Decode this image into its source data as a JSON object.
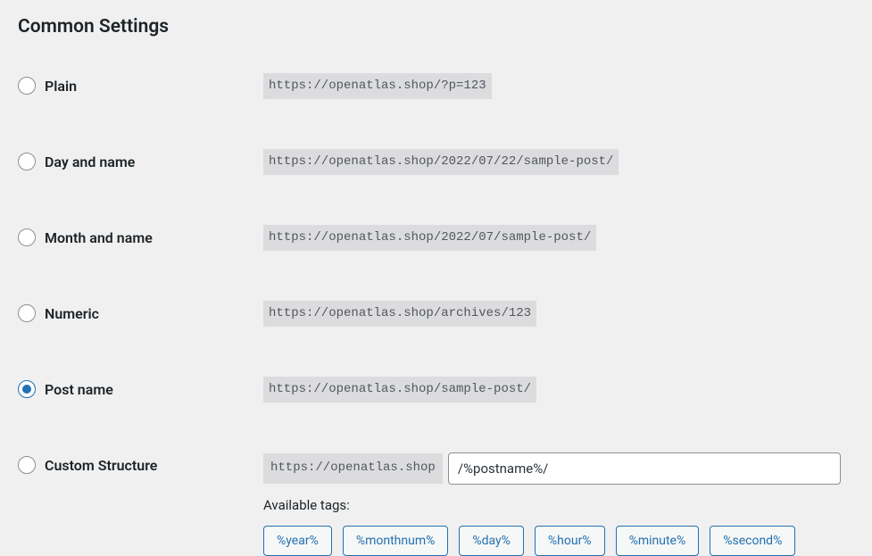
{
  "heading": "Common Settings",
  "options": {
    "plain": {
      "label": "Plain",
      "example": "https://openatlas.shop/?p=123"
    },
    "day_name": {
      "label": "Day and name",
      "example": "https://openatlas.shop/2022/07/22/sample-post/"
    },
    "month_name": {
      "label": "Month and name",
      "example": "https://openatlas.shop/2022/07/sample-post/"
    },
    "numeric": {
      "label": "Numeric",
      "example": "https://openatlas.shop/archives/123"
    },
    "post_name": {
      "label": "Post name",
      "example": "https://openatlas.shop/sample-post/"
    },
    "custom": {
      "label": "Custom Structure",
      "prefix": "https://openatlas.shop",
      "value": "/%postname%/"
    }
  },
  "tags_label": "Available tags:",
  "tags": {
    "t0": "%year%",
    "t1": "%monthnum%",
    "t2": "%day%",
    "t3": "%hour%",
    "t4": "%minute%",
    "t5": "%second%"
  }
}
